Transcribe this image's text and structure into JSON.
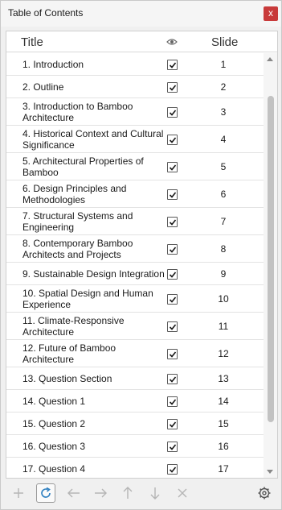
{
  "window": {
    "title": "Table of Contents",
    "close_label": "x"
  },
  "table": {
    "col_title": "Title",
    "col_visible_icon": "eye-icon",
    "col_slide": "Slide",
    "rows": [
      {
        "title": "1. Introduction",
        "visible": true,
        "slide": "1"
      },
      {
        "title": "2. Outline",
        "visible": true,
        "slide": "2"
      },
      {
        "title": "3. Introduction to Bamboo Architecture",
        "visible": true,
        "slide": "3"
      },
      {
        "title": "4. Historical Context and Cultural Significance",
        "visible": true,
        "slide": "4"
      },
      {
        "title": "5. Architectural Properties of Bamboo",
        "visible": true,
        "slide": "5"
      },
      {
        "title": "6. Design Principles and Methodologies",
        "visible": true,
        "slide": "6"
      },
      {
        "title": "7. Structural Systems and Engineering",
        "visible": true,
        "slide": "7"
      },
      {
        "title": "8. Contemporary Bamboo Architects and Projects",
        "visible": true,
        "slide": "8"
      },
      {
        "title": "9. Sustainable Design Integration",
        "visible": true,
        "slide": "9"
      },
      {
        "title": "10. Spatial Design and Human Experience",
        "visible": true,
        "slide": "10"
      },
      {
        "title": "11. Climate-Responsive Architecture",
        "visible": true,
        "slide": "11"
      },
      {
        "title": "12. Future of Bamboo Architecture",
        "visible": true,
        "slide": "12"
      },
      {
        "title": "13. Question Section",
        "visible": true,
        "slide": "13"
      },
      {
        "title": "14. Question 1",
        "visible": true,
        "slide": "14"
      },
      {
        "title": "15. Question 2",
        "visible": true,
        "slide": "15"
      },
      {
        "title": "16. Question 3",
        "visible": true,
        "slide": "16"
      },
      {
        "title": "17. Question 4",
        "visible": true,
        "slide": "17"
      }
    ]
  },
  "toolbar": {
    "buttons": [
      "add-icon",
      "refresh-icon",
      "arrow-left-icon",
      "arrow-right-icon",
      "arrow-up-icon",
      "arrow-down-icon",
      "delete-icon",
      "settings-icon"
    ]
  },
  "colors": {
    "close_button": "#c83a3a",
    "checkbox_border": "#5a5a5a",
    "refresh_icon": "#2e7fc0",
    "disabled_icon": "#b5b5b5"
  }
}
